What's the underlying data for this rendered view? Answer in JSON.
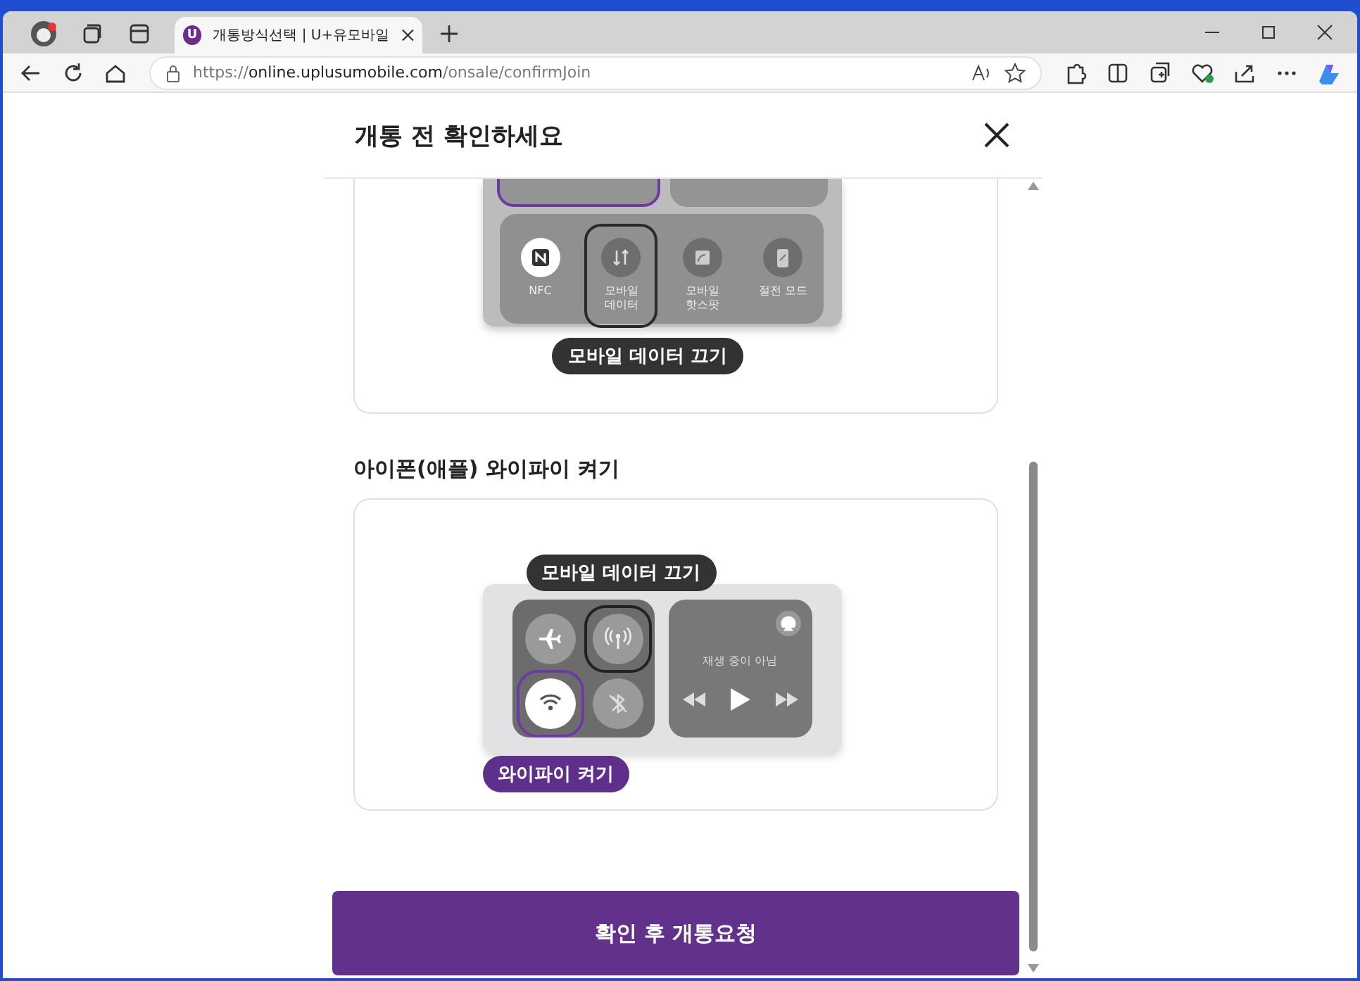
{
  "browser": {
    "tab": {
      "title": "개통방식선택 | U+유모바일",
      "favicon": "U"
    },
    "address": {
      "scheme": "https://",
      "host": "online.uplusumobile.com",
      "path": "/onsale/confirmJoin"
    }
  },
  "modal": {
    "title": "개통 전 확인하세요"
  },
  "android_panel": {
    "toggles": [
      {
        "kind": "nfc",
        "label": "NFC",
        "on": true,
        "highlighted": false
      },
      {
        "kind": "data",
        "label": "모바일\n데이터",
        "on": false,
        "highlighted": true
      },
      {
        "kind": "hotspot",
        "label": "모바일\n핫스팟",
        "on": false,
        "highlighted": false
      },
      {
        "kind": "battery",
        "label": "절전 모드",
        "on": false,
        "highlighted": false
      }
    ],
    "callout": "모바일 데이터 끄기"
  },
  "section_title": "아이폰(애플) 와이파이 켜기",
  "ios_panel": {
    "toggles": [
      {
        "kind": "airplane",
        "on": false,
        "highlighted": false
      },
      {
        "kind": "cellular",
        "on": false,
        "highlighted": true
      },
      {
        "kind": "wifi",
        "on": true,
        "highlighted": true
      },
      {
        "kind": "bluetooth",
        "on": false,
        "highlighted": false
      }
    ],
    "now_playing": "재생 중이 아님",
    "callouts": [
      {
        "kind": "dark",
        "text": "모바일 데이터 끄기"
      },
      {
        "kind": "purple",
        "text": "와이파이 켜기"
      }
    ]
  },
  "confirm_button": "확인 후 개통요청"
}
